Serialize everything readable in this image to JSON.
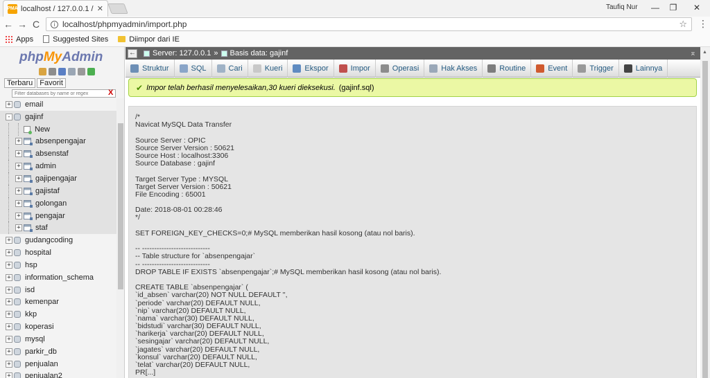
{
  "browser": {
    "tab_title": "localhost / 127.0.0.1 / ga",
    "tab_close": "✕",
    "user": "Taufiq Nur",
    "url": "localhost/phpmyadmin/import.php",
    "controls": {
      "minimize": "—",
      "restore": "❐",
      "close": "✕"
    },
    "nav": {
      "back": "←",
      "forward": "→",
      "reload": "C"
    },
    "star": "☆",
    "menu": "⋮",
    "bookmarks": [
      {
        "label": "Apps"
      },
      {
        "label": "Suggested Sites"
      },
      {
        "label": "Diimpor dari IE"
      }
    ]
  },
  "sidebar": {
    "logo": {
      "php": "php",
      "my": "My",
      "admin": "Admin"
    },
    "tabs": {
      "recent": "Terbaru",
      "favorite": "Favorit"
    },
    "filter_placeholder": "Filter databases by name or regex",
    "filter_clear": "X",
    "tree": [
      {
        "label": "email",
        "type": "db",
        "sign": "+"
      },
      {
        "label": "gajinf",
        "type": "db",
        "sign": "-",
        "highlight": true
      },
      {
        "label": "New",
        "type": "new",
        "child": true
      },
      {
        "label": "absenpengajar",
        "type": "table",
        "child": true,
        "sign": "+"
      },
      {
        "label": "absenstaf",
        "type": "table",
        "child": true,
        "sign": "+"
      },
      {
        "label": "admin",
        "type": "table",
        "child": true,
        "sign": "+"
      },
      {
        "label": "gajipengajar",
        "type": "table",
        "child": true,
        "sign": "+"
      },
      {
        "label": "gajistaf",
        "type": "table",
        "child": true,
        "sign": "+"
      },
      {
        "label": "golongan",
        "type": "table",
        "child": true,
        "sign": "+"
      },
      {
        "label": "pengajar",
        "type": "table",
        "child": true,
        "sign": "+"
      },
      {
        "label": "staf",
        "type": "table",
        "child": true,
        "sign": "+",
        "last": true
      },
      {
        "label": "gudangcoding",
        "type": "db",
        "sign": "+"
      },
      {
        "label": "hospital",
        "type": "db",
        "sign": "+"
      },
      {
        "label": "hsp",
        "type": "db",
        "sign": "+"
      },
      {
        "label": "information_schema",
        "type": "db",
        "sign": "+"
      },
      {
        "label": "isd",
        "type": "db",
        "sign": "+"
      },
      {
        "label": "kemenpar",
        "type": "db",
        "sign": "+"
      },
      {
        "label": "kkp",
        "type": "db",
        "sign": "+"
      },
      {
        "label": "koperasi",
        "type": "db",
        "sign": "+"
      },
      {
        "label": "mysql",
        "type": "db",
        "sign": "+"
      },
      {
        "label": "parkir_db",
        "type": "db",
        "sign": "+"
      },
      {
        "label": "penjualan",
        "type": "db",
        "sign": "+"
      },
      {
        "label": "penjualan2",
        "type": "db",
        "sign": "+"
      }
    ]
  },
  "breadcrumb": {
    "server": "Server: 127.0.0.1",
    "separator": "»",
    "database": "Basis data: gajinf",
    "collapse": "←",
    "right": "⌅"
  },
  "topmenu": [
    {
      "label": "Struktur",
      "icon": "structure-icon",
      "color": "#6d8fb6"
    },
    {
      "label": "SQL",
      "icon": "sql-icon",
      "color": "#8aa5c8"
    },
    {
      "label": "Cari",
      "icon": "search-icon",
      "color": "#9fb2c6"
    },
    {
      "label": "Kueri",
      "icon": "query-icon",
      "color": "#c8c8c8"
    },
    {
      "label": "Ekspor",
      "icon": "export-icon",
      "color": "#5f8bc1"
    },
    {
      "label": "Impor",
      "icon": "import-icon",
      "color": "#c0504d"
    },
    {
      "label": "Operasi",
      "icon": "wrench-icon",
      "color": "#8c8c8c"
    },
    {
      "label": "Hak Akses",
      "icon": "privileges-icon",
      "color": "#9aa8b8"
    },
    {
      "label": "Routine",
      "icon": "routine-icon",
      "color": "#7d7d7d"
    },
    {
      "label": "Event",
      "icon": "clock-icon",
      "color": "#d05a2f"
    },
    {
      "label": "Trigger",
      "icon": "trigger-icon",
      "color": "#999999"
    },
    {
      "label": "Lainnya",
      "icon": "caret-down-icon",
      "color": "#444444"
    }
  ],
  "message": {
    "check": "✔",
    "text_italic": "Impor telah berhasil menyelesaikan,30 kueri dieksekusi.",
    "file": "(gajinf.sql)"
  },
  "sql_lines": [
    "/*",
    "Navicat MySQL Data Transfer",
    "",
    "Source Server : OPIC",
    "Source Server Version : 50621",
    "Source Host : localhost:3306",
    "Source Database : gajinf",
    "",
    "Target Server Type : MYSQL",
    "Target Server Version : 50621",
    "File Encoding : 65001",
    "",
    "Date: 2018-08-01 00:28:46",
    "*/",
    "",
    "SET FOREIGN_KEY_CHECKS=0;# MySQL memberikan hasil kosong (atau nol baris).",
    "",
    "-- ----------------------------",
    "-- Table structure for `absenpengajar`",
    "-- ----------------------------",
    "DROP TABLE IF EXISTS `absenpengajar`;# MySQL memberikan hasil kosong (atau nol baris).",
    "",
    "CREATE TABLE `absenpengajar` (",
    "`id_absen` varchar(20) NOT NULL DEFAULT '',",
    "`periode` varchar(20) DEFAULT NULL,",
    "`nip` varchar(20) DEFAULT NULL,",
    "`nama` varchar(30) DEFAULT NULL,",
    "`bidstudi` varchar(30) DEFAULT NULL,",
    "`harikerja` varchar(20) DEFAULT NULL,",
    "`sesingajar` varchar(20) DEFAULT NULL,",
    "`jagates` varchar(20) DEFAULT NULL,",
    "`konsul` varchar(20) DEFAULT NULL,",
    "`telat` varchar(20) DEFAULT NULL,",
    "PR[...]"
  ]
}
